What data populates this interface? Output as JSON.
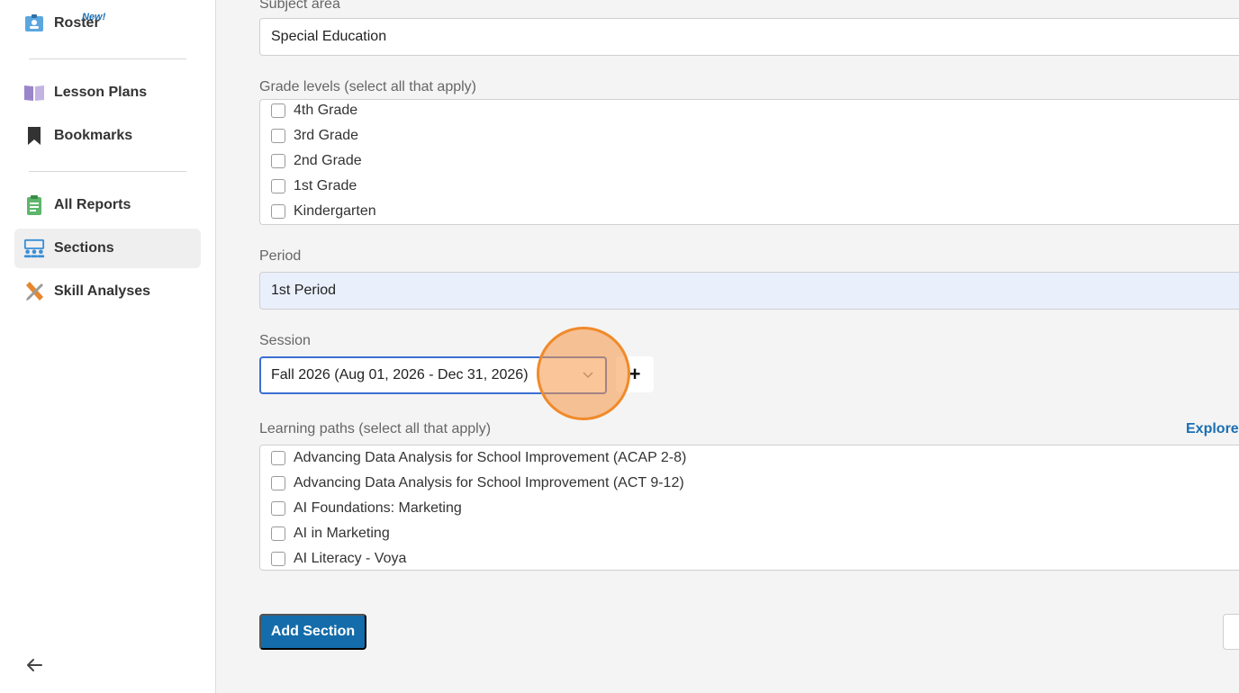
{
  "sidebar": {
    "items": [
      {
        "label": "Roster",
        "icon": "roster-icon",
        "badge": "New!"
      },
      {
        "label": "Lesson Plans",
        "icon": "book-icon"
      },
      {
        "label": "Bookmarks",
        "icon": "bookmark-icon"
      },
      {
        "label": "All Reports",
        "icon": "clipboard-icon"
      },
      {
        "label": "Sections",
        "icon": "classroom-icon",
        "active": true
      },
      {
        "label": "Skill Analyses",
        "icon": "tools-icon"
      }
    ],
    "collapse_icon": "arrow-left-icon"
  },
  "form": {
    "subject_area": {
      "label": "Subject area",
      "value": "Special Education"
    },
    "grade_levels": {
      "label": "Grade levels (select all that apply)",
      "options": [
        "4th Grade",
        "3rd Grade",
        "2nd Grade",
        "1st Grade",
        "Kindergarten"
      ]
    },
    "period": {
      "label": "Period",
      "value": "1st Period"
    },
    "session": {
      "label": "Session",
      "value": "Fall 2026 (Aug 01, 2026 - Dec 31, 2026)",
      "add_label": "+"
    },
    "learning_paths": {
      "label": "Learning paths (select all that apply)",
      "explore_link": "Explore",
      "options": [
        "Advancing Data Analysis for School Improvement (ACAP 2-8)",
        "Advancing Data Analysis for School Improvement (ACT 9-12)",
        "AI Foundations: Marketing",
        "AI in Marketing",
        "AI Literacy - Voya"
      ]
    },
    "submit_label": "Add Section"
  },
  "colors": {
    "primary": "#146caa",
    "link": "#1b6fb3",
    "focus_border": "#3c6fd1",
    "highlight": "#f08a2a"
  }
}
